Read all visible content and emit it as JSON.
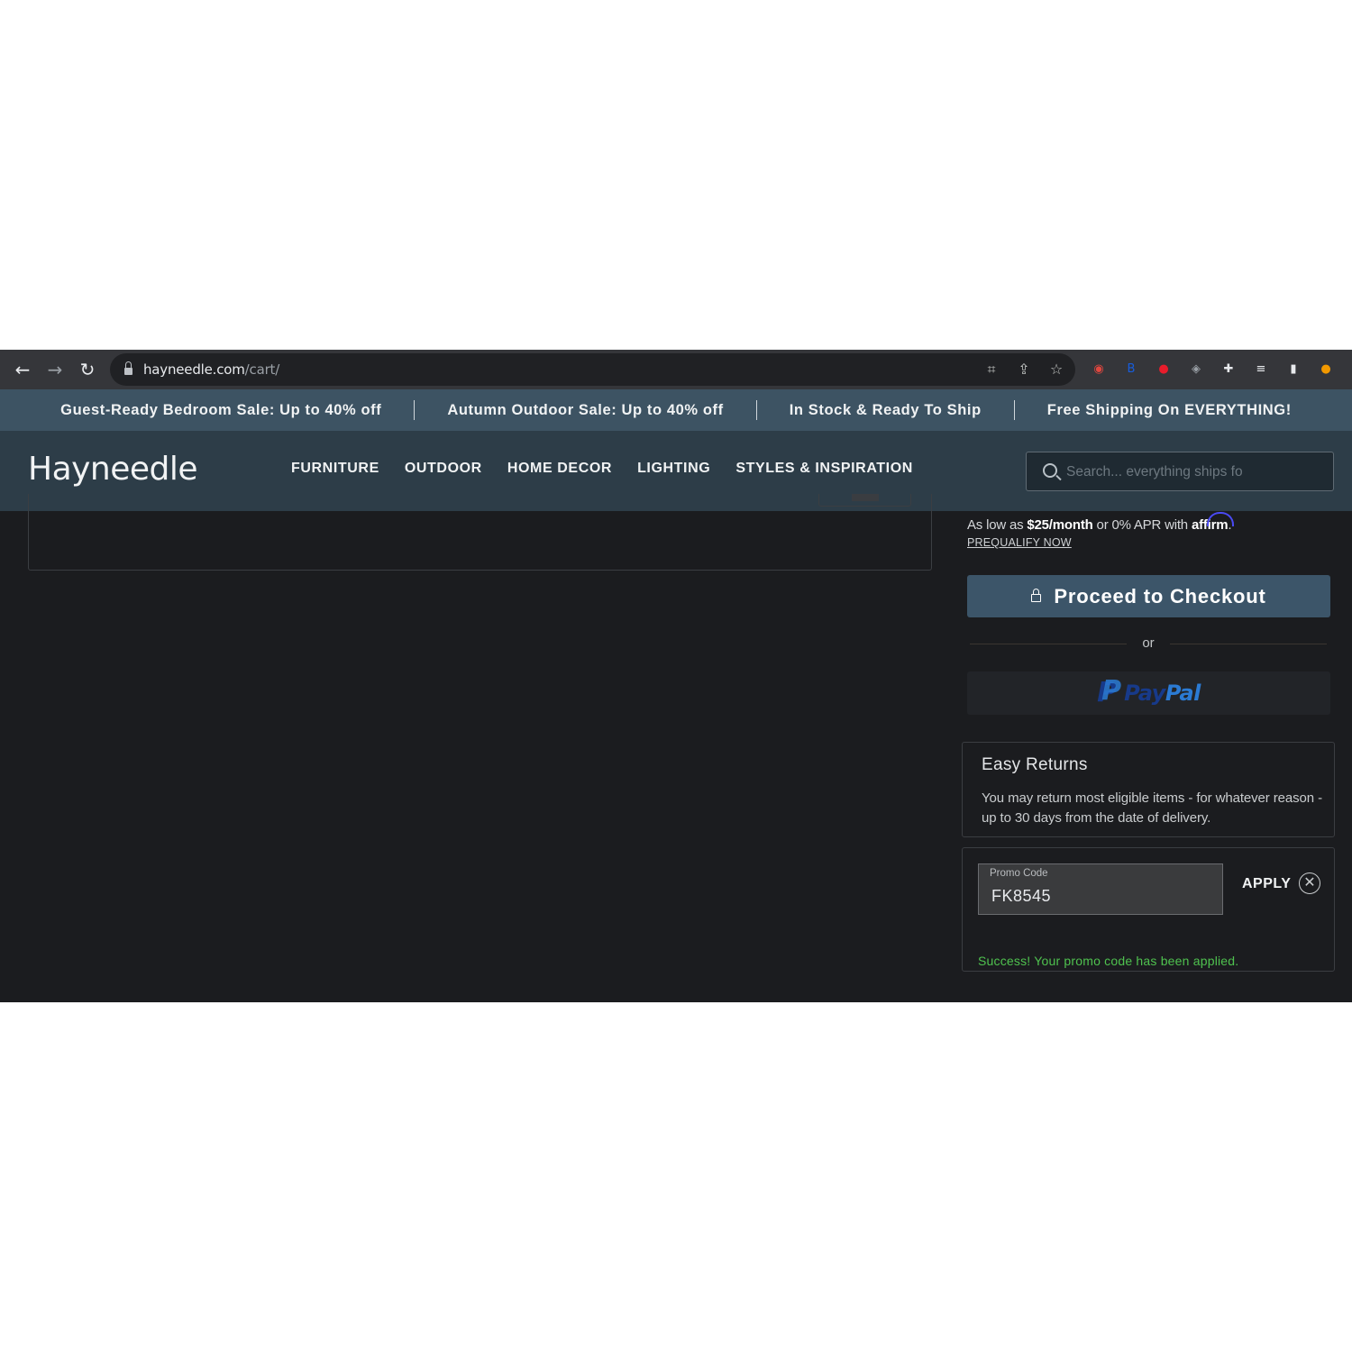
{
  "browser": {
    "url_host": "hayneedle.com",
    "url_path": "/cart/",
    "nav_icons": {
      "back": "←",
      "forward": "→",
      "reload": "↻"
    },
    "omnibox_icons": [
      "translate-icon",
      "share-icon",
      "bookmark-star-icon"
    ],
    "omnibox_glyphs": {
      "translate": "⌗",
      "share": "⇪",
      "star": "☆"
    },
    "extensions": [
      {
        "name": "extension-spy-icon",
        "glyph": "◉",
        "color": "#e0473f"
      },
      {
        "name": "extension-bitwarden-icon",
        "glyph": "B",
        "color": "#175ddc"
      },
      {
        "name": "extension-red-shield-icon",
        "glyph": "●",
        "color": "#e81c2b"
      },
      {
        "name": "extension-shield-icon",
        "glyph": "◈",
        "color": "#9aa0a6"
      },
      {
        "name": "extensions-puzzle-icon",
        "glyph": "✚",
        "color": "#e8eaed"
      },
      {
        "name": "reading-list-icon",
        "glyph": "≡",
        "color": "#e8eaed"
      },
      {
        "name": "side-panel-icon",
        "glyph": "▮",
        "color": "#e8eaed"
      },
      {
        "name": "profile-avatar-icon",
        "glyph": "●",
        "color": "#f29900"
      }
    ]
  },
  "promo_banner": [
    "Guest-Ready Bedroom Sale: Up to 40% off",
    "Autumn Outdoor Sale: Up to 40% off",
    "In Stock & Ready To Ship",
    "Free Shipping On EVERYTHING!"
  ],
  "header": {
    "logo": "Hayneedle",
    "nav": [
      "FURNITURE",
      "OUTDOOR",
      "HOME DECOR",
      "LIGHTING",
      "STYLES & INSPIRATION"
    ],
    "search_placeholder": "Search... everything ships fo"
  },
  "summary": {
    "affirm_prefix": "As low as ",
    "affirm_amount": "$25/month",
    "affirm_middle": " or 0% APR with ",
    "affirm_brand": "affirm",
    "affirm_suffix": ".",
    "prequalify": "PREQUALIFY NOW",
    "checkout_label": "Proceed to Checkout",
    "or_label": "or",
    "paypal_pay": "Pay",
    "paypal_pal": "Pal"
  },
  "returns": {
    "title": "Easy Returns",
    "body": "You may return most eligible items - for whatever reason - up to 30 days from the date of delivery."
  },
  "promo": {
    "label": "Promo Code",
    "value": "FK8545",
    "apply_label": "APPLY",
    "clear_glyph": "✕",
    "success_message": "Success! Your promo code has been applied."
  },
  "colors": {
    "page_bg": "#1b1c1f",
    "promo_bar": "#3d5363",
    "header_bg": "#2d3d48",
    "checkout_btn": "#3c5569",
    "success": "#4fc24f",
    "paypal_dark": "#173a8a",
    "paypal_light": "#2b7bd4"
  }
}
